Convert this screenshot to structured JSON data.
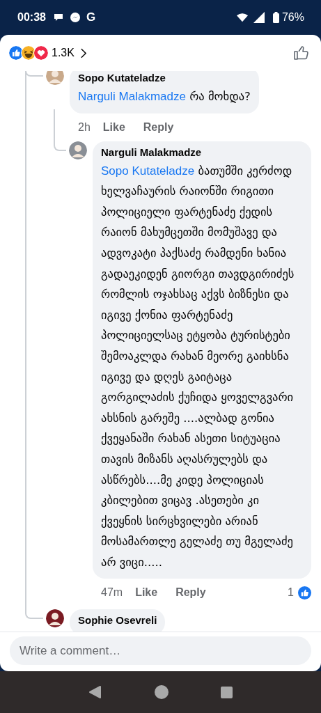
{
  "status_bar": {
    "time": "00:38",
    "notification_letter": "G",
    "battery": "76%"
  },
  "reactions": {
    "count": "1.3K"
  },
  "comments": [
    {
      "author": "Sopo Kutateladze",
      "mention": "Narguli Malakmadze",
      "text": "რა მოხდა?",
      "time": "2h",
      "actions": [
        "Like",
        "Reply"
      ],
      "children": [
        {
          "author": "Narguli Malakmadze",
          "mention": "Sopo Kutateladze",
          "text": "ბათუმში კერძოდ ხელვაჩაურის რაიონში რიგითი პოლიციელი ფარტენაძე ქედის რაიონ მახუმცეთში მომუშავე და ადვოკატი პაქსაძე რამდენი ხანია გადაეკიდენ გიორგი თავდგირიძეს რომლის ოჯახსაც აქვს ბიზნესი და იგივე ქონია ფარტენაძე პოლიციელსაც ეტყობა ტურისტები შემოაკლდა რახან მეორე გაიხსნა იგივე და დღეს გაიტაცა გორგილაძის ქუჩიდა ყოველგვარი ახსნის გარეშე ....ალბად გონია ქვეყანაში რახან ასეთი სიტუაცია თავის მიზანს აღასრულებს და ასწრებს....მე კიდე პოლიციას კბილებით ვიცავ .ასეთები კი ქვეყნის სირცხვილები არიან მოსამართლე გელაძე თუ მგელაძე არ ვიცი.....",
          "time": "47m",
          "actions": [
            "Like",
            "Reply"
          ],
          "like_count": "1"
        }
      ]
    },
    {
      "author": "Sophie Osevreli"
    }
  ],
  "composer": {
    "placeholder": "Write a comment…"
  }
}
